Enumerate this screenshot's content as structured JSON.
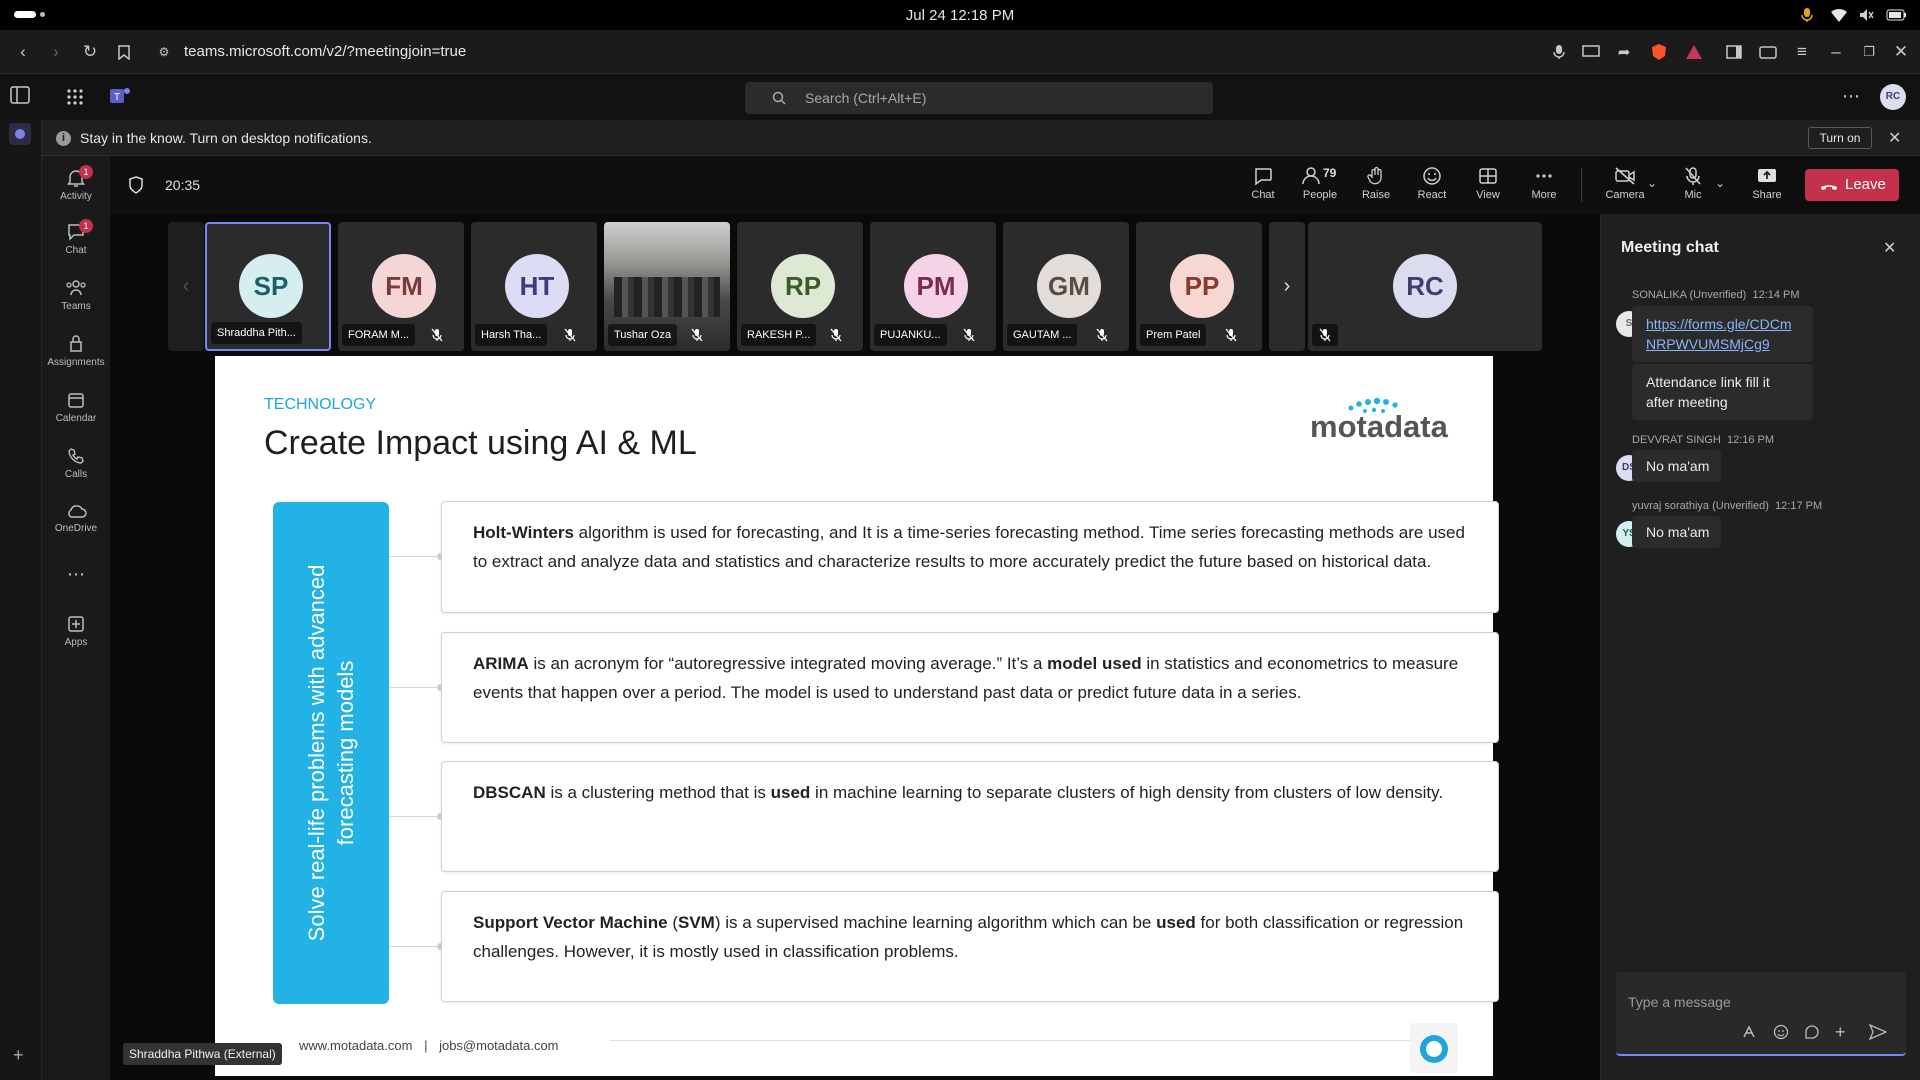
{
  "os": {
    "clock": "Jul 24  12:18 PM"
  },
  "browser": {
    "url": "teams.microsoft.com/v2/?meetingjoin=true"
  },
  "search": {
    "placeholder": "Search (Ctrl+Alt+E)"
  },
  "user_initials": "RC",
  "rail": [
    {
      "label": "Activity",
      "badge": "1",
      "icon": "bell-icon"
    },
    {
      "label": "Chat",
      "badge": "1",
      "icon": "chat-icon"
    },
    {
      "label": "Teams",
      "badge": "",
      "icon": "teams-icon"
    },
    {
      "label": "Assignments",
      "badge": "",
      "icon": "assignments-icon"
    },
    {
      "label": "Calendar",
      "badge": "",
      "icon": "calendar-icon"
    },
    {
      "label": "Calls",
      "badge": "",
      "icon": "phone-icon"
    },
    {
      "label": "OneDrive",
      "badge": "",
      "icon": "cloud-icon"
    },
    {
      "label": "Apps",
      "badge": "",
      "icon": "apps-icon"
    }
  ],
  "notification": {
    "text": "Stay in the know. Turn on desktop notifications.",
    "button": "Turn on"
  },
  "meeting": {
    "timer": "20:35",
    "people_count": "79",
    "toolbar": [
      "Chat",
      "People",
      "Raise",
      "React",
      "View",
      "More",
      "Camera",
      "Mic",
      "Share"
    ],
    "leave": "Leave"
  },
  "participants": [
    {
      "initials": "SP",
      "name": "Shraddha Pith...",
      "bg": "#d5eef0",
      "fg": "#1d5f66",
      "muted": false
    },
    {
      "initials": "FM",
      "name": "FORAM M...",
      "bg": "#f4d6d6",
      "fg": "#7a3a3a",
      "muted": true
    },
    {
      "initials": "HT",
      "name": "Harsh Tha...",
      "bg": "#dcdcf4",
      "fg": "#3b3d78",
      "muted": true
    },
    {
      "initials": "",
      "name": "Tushar Oza",
      "bg": "",
      "fg": "",
      "muted": true
    },
    {
      "initials": "RP",
      "name": "RAKESH P...",
      "bg": "#dde9d2",
      "fg": "#3c5a2a",
      "muted": true
    },
    {
      "initials": "PM",
      "name": "PUJANKU...",
      "bg": "#f6d2e6",
      "fg": "#7a2a56",
      "muted": true
    },
    {
      "initials": "GM",
      "name": "GAUTAM ...",
      "bg": "#e2ddd9",
      "fg": "#5a4c42",
      "muted": true
    },
    {
      "initials": "PP",
      "name": "Prem Patel",
      "bg": "#f7d7d2",
      "fg": "#8a3a2e",
      "muted": true
    },
    {
      "initials": "RC",
      "name": "",
      "bg": "#dcdcef",
      "fg": "#3e3f70",
      "muted": true
    }
  ],
  "slide": {
    "category": "TECHNOLOGY",
    "title": "Create Impact using AI & ML",
    "logo": "motadata",
    "side_text": "Solve real-life problems with advanced forecasting models",
    "cards": [
      {
        "bold": "Holt-Winters",
        "rest": " algorithm is used for forecasting, and It is a time-series forecasting method. Time series forecasting methods are used to extract and analyze data and statistics and characterize results to more accurately predict the future based on historical data."
      },
      {
        "bold": "ARIMA",
        "rest1": " is an acronym for “autoregressive integrated moving average.” It’s a ",
        "bold2": "model used",
        "rest2": " in statistics and econometrics to measure events that happen over a period. The model is used to understand past data or predict future data in a series."
      },
      {
        "bold": "DBSCAN",
        "rest1": " is a clustering method that is ",
        "bold2": "used",
        "rest2": " in machine learning to separate clusters of high density from clusters of low density."
      },
      {
        "bold": "Support Vector Machine",
        "mid": " (",
        "bold_b": "SVM",
        "mid2": ") is a supervised machine learning algorithm which can be ",
        "bold2": "used",
        "rest2": " for both classification or regression challenges. However, it is mostly used in classification problems."
      }
    ],
    "footer_site": "www.motadata.com",
    "footer_sep": "|",
    "footer_mail": "jobs@motadata.com"
  },
  "presenter_tag": "Shraddha Pithwa (External)",
  "chat": {
    "title": "Meeting chat",
    "messages": [
      {
        "sender": "SONALIKA (Unverified)",
        "time": "12:14 PM",
        "initials": "S",
        "link": "https://forms.gle/CDCmNRPWVUMSMjCg9",
        "text": "Attendance link fill it after meeting"
      },
      {
        "sender": "DEVVRAT SINGH",
        "time": "12:16 PM",
        "initials": "DS",
        "text": "No ma'am"
      },
      {
        "sender": "yuvraj sorathiya (Unverified)",
        "time": "12:17 PM",
        "initials": "YS",
        "text": "No ma'am"
      }
    ],
    "compose_placeholder": "Type a message"
  }
}
